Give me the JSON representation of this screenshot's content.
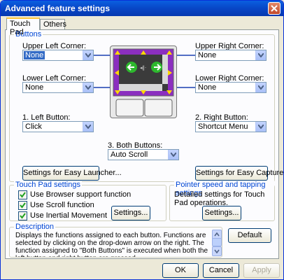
{
  "window": {
    "title": "Advanced feature settings"
  },
  "tabs": [
    {
      "label": "Touch Pad"
    },
    {
      "label": "Others"
    }
  ],
  "buttons_group": {
    "title": "Buttons",
    "upper_left": {
      "label": "Upper Left Corner:",
      "value": "None"
    },
    "upper_right": {
      "label": "Upper Right Corner:",
      "value": "None"
    },
    "lower_left": {
      "label": "Lower Left Corner:",
      "value": "None"
    },
    "lower_right": {
      "label": "Lower Right Corner:",
      "value": "None"
    },
    "left_button": {
      "label": "1. Left Button:",
      "value": "Click"
    },
    "right_button": {
      "label": "2. Right Button:",
      "value": "Shortcut Menu"
    },
    "both_buttons": {
      "label": "3. Both Buttons:",
      "value": "Auto Scroll"
    },
    "easy_launcher_label": "Settings for Easy Launcher...",
    "easy_capture_label": "Settings for Easy Capture..."
  },
  "touchpad_settings": {
    "title": "Touch Pad settings",
    "options": [
      {
        "label": "Use Browser support function",
        "checked": true
      },
      {
        "label": "Use Scroll function",
        "checked": true
      },
      {
        "label": "Use Inertial Movement",
        "checked": true
      }
    ],
    "settings_label": "Settings..."
  },
  "pointer_settings": {
    "title": "Pointer speed and tapping settings",
    "text": "Detailed settings for Touch Pad operations.",
    "settings_label": "Settings..."
  },
  "description": {
    "title": "Description",
    "text": "Displays the functions assigned to each button. Functions are selected by clicking on the drop-down arrow on the right. The function assigned to \"Both Buttons\" is executed when both the left button and right button are pressed"
  },
  "default_label": "Default",
  "footer": {
    "ok": "OK",
    "cancel": "Cancel",
    "apply": "Apply"
  },
  "colors": {
    "title_bar": "#0846c6",
    "group_title": "#0046d5",
    "pad_arrow": "#ffd700",
    "pad_green": "#2db82d"
  }
}
